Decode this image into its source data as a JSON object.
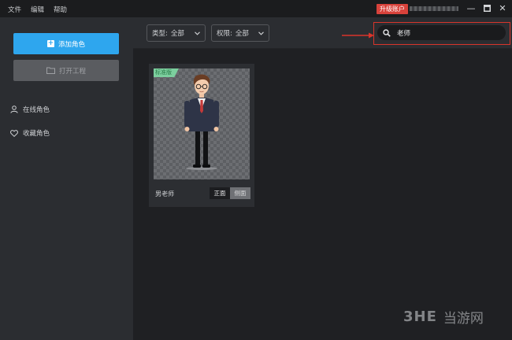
{
  "menu": {
    "items": [
      "文件",
      "编辑",
      "帮助"
    ]
  },
  "titlebar": {
    "upgrade_label": "升级账户"
  },
  "sidebar": {
    "add_role_label": "添加角色",
    "open_project_label": "打开工程",
    "items": [
      {
        "label": "在线角色",
        "icon": "user-icon"
      },
      {
        "label": "收藏角色",
        "icon": "heart-icon"
      }
    ]
  },
  "toolbar": {
    "type_filter": {
      "label": "类型:",
      "value": "全部"
    },
    "permission_filter": {
      "label": "权限:",
      "value": "全部"
    },
    "search": {
      "value": "老师"
    }
  },
  "cards": [
    {
      "tag": "标准版",
      "name": "男老师",
      "view_front": "正面",
      "view_side": "侧面"
    }
  ],
  "watermark": {
    "logo": "3HE",
    "text": "当游网"
  },
  "colors": {
    "accent": "#2ea6ee",
    "upgrade": "#d8423b",
    "highlight_box": "#d9352b",
    "tag": "#7ccf9e"
  }
}
